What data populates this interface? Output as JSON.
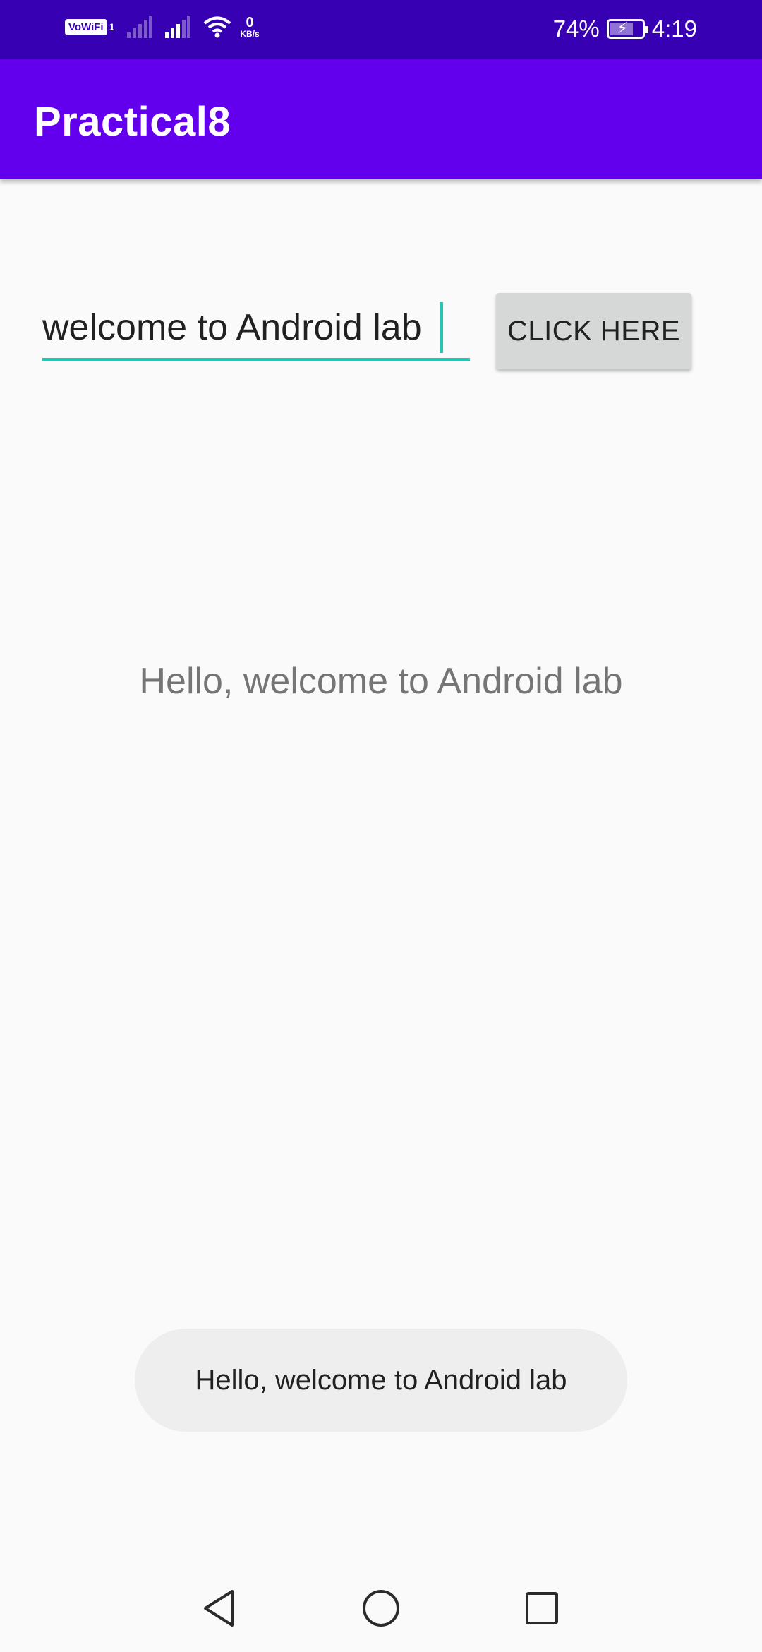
{
  "status_bar": {
    "vowifi_label": "VoWiFi",
    "vowifi_sim": "1",
    "speed_value": "0",
    "speed_unit": "KB/s",
    "battery_percent": "74%",
    "battery_level": 0.74,
    "time": "4:19"
  },
  "app_bar": {
    "title": "Practical8"
  },
  "main": {
    "input_value": "welcome to Android lab",
    "button_label": "CLICK HERE",
    "output_text": "Hello, welcome to Android lab"
  },
  "toast": {
    "message": "Hello, welcome to Android lab"
  },
  "nav_bar": {
    "back_icon": "back-triangle-icon",
    "home_icon": "home-circle-icon",
    "recents_icon": "recents-square-icon"
  },
  "colors": {
    "status_bar": "#3700b3",
    "app_bar": "#6200ee",
    "accent": "#26c6b4",
    "button": "#d6d7d7",
    "toast": "#eeeeee"
  }
}
